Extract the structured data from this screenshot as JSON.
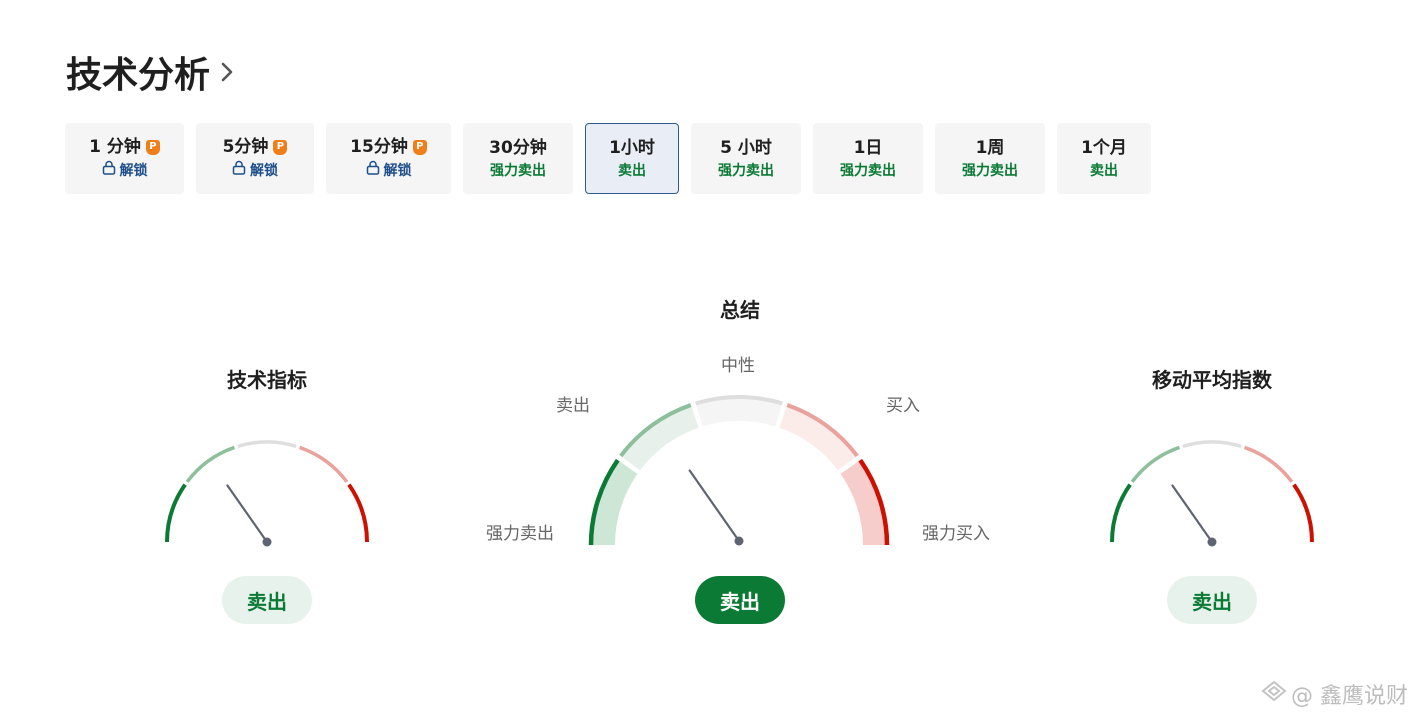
{
  "header": {
    "title": "技术分析"
  },
  "tabs": [
    {
      "label": "1 分钟",
      "sub": "解锁",
      "locked": true
    },
    {
      "label": "5分钟",
      "sub": "解锁",
      "locked": true
    },
    {
      "label": "15分钟",
      "sub": "解锁",
      "locked": true
    },
    {
      "label": "30分钟",
      "sub": "强力卖出",
      "locked": false
    },
    {
      "label": "1小时",
      "sub": "卖出",
      "locked": false,
      "active": true
    },
    {
      "label": "5 小时",
      "sub": "强力卖出",
      "locked": false
    },
    {
      "label": "1日",
      "sub": "强力卖出",
      "locked": false
    },
    {
      "label": "1周",
      "sub": "强力卖出",
      "locked": false
    },
    {
      "label": "1个月",
      "sub": "卖出",
      "locked": false
    }
  ],
  "pro_badge": "P",
  "gauges": {
    "indicators": {
      "title": "技术指标",
      "result": "卖出",
      "needle_deg": -35
    },
    "summary": {
      "title": "总结",
      "result": "卖出",
      "needle_deg": -35,
      "scale": {
        "strong_sell": "强力卖出",
        "sell": "卖出",
        "neutral": "中性",
        "buy": "买入",
        "strong_buy": "强力买入"
      }
    },
    "moving_averages": {
      "title": "移动平均指数",
      "result": "卖出",
      "needle_deg": -35
    }
  },
  "colors": {
    "strong_sell": "#0b7a35",
    "sell": "#8dbf9c",
    "neutral": "#dedede",
    "buy": "#eaa29c",
    "strong_buy": "#cc1100"
  },
  "watermark": "@ 鑫鹰说财"
}
